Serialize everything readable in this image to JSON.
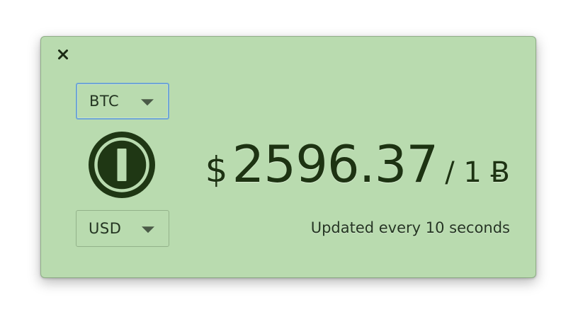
{
  "window": {
    "background_color": "#b9dbaf",
    "text_color": "#1d3312",
    "close_icon": "close-icon"
  },
  "converter": {
    "from_currency": "BTC",
    "to_currency": "USD",
    "logo_icon": "coin-logo-icon"
  },
  "price": {
    "currency_symbol": "$",
    "value": "2596.37",
    "per_unit": "/ 1 Ƀ"
  },
  "status": {
    "update_note": "Updated every 10 seconds"
  }
}
